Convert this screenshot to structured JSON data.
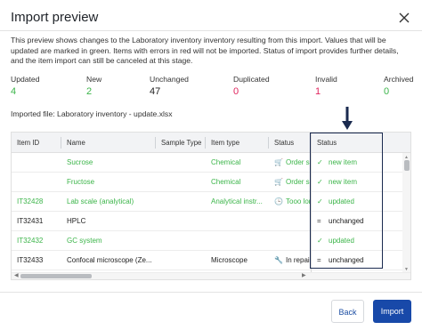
{
  "dialog": {
    "title": "Import preview",
    "description": "This preview shows changes to the Laboratory inventory inventory resulting from this import. Values that will be updated are marked in green. Items with errors in red will not be imported. Status of import provides further details, and the item import can still be canceled at this stage.",
    "imported_file": "Imported file: Laboratory inventory - update.xlsx"
  },
  "stats": [
    {
      "label": "Updated",
      "value": "4",
      "color": "#3cb54a"
    },
    {
      "label": "New",
      "value": "2",
      "color": "#3cb54a"
    },
    {
      "label": "Unchanged",
      "value": "47",
      "color": "#222222"
    },
    {
      "label": "Duplicated",
      "value": "0",
      "color": "#e0245e"
    },
    {
      "label": "Invalid",
      "value": "1",
      "color": "#e0245e"
    },
    {
      "label": "Archived",
      "value": "0",
      "color": "#3cb54a"
    }
  ],
  "table": {
    "headers": [
      "Item ID",
      "Name",
      "Sample Type",
      "Item type",
      "Status",
      "Status"
    ],
    "rows": [
      {
        "item_id": "",
        "name": "Sucrose",
        "sample_type": "",
        "item_type": "Chemical",
        "status_icon": "cart-icon",
        "status": "Order su",
        "import_icon": "check-icon",
        "import_status": "new item",
        "name_color": "green",
        "import_color": "green"
      },
      {
        "item_id": "",
        "name": "Fructose",
        "sample_type": "",
        "item_type": "Chemical",
        "status_icon": "cart-icon",
        "status": "Order su",
        "import_icon": "check-icon",
        "import_status": "new item",
        "name_color": "green",
        "import_color": "green"
      },
      {
        "item_id": "IT32428",
        "name": "Lab scale (analytical)",
        "sample_type": "",
        "item_type": "Analytical instr...",
        "status_icon": "clock-icon",
        "status": "Tooo lon",
        "import_icon": "check-icon",
        "import_status": "updated",
        "name_color": "green",
        "import_color": "green"
      },
      {
        "item_id": "IT32431",
        "name": "HPLC",
        "sample_type": "",
        "item_type": "",
        "status_icon": "",
        "status": "",
        "import_icon": "equals-icon",
        "import_status": "unchanged",
        "name_color": "dark",
        "import_color": "dark"
      },
      {
        "item_id": "IT32432",
        "name": "GC system",
        "sample_type": "",
        "item_type": "",
        "status_icon": "",
        "status": "",
        "import_icon": "check-icon",
        "import_status": "updated",
        "name_color": "green",
        "import_color": "green"
      },
      {
        "item_id": "IT32433",
        "name": "Confocal microscope (Ze...",
        "sample_type": "",
        "item_type": "Microscope",
        "status_icon": "wrench-icon",
        "status": "In repair",
        "import_icon": "equals-icon",
        "import_status": "unchanged",
        "name_color": "dark",
        "import_color": "dark"
      }
    ]
  },
  "buttons": {
    "back": "Back",
    "import": "Import"
  },
  "colors": {
    "green": "#3cb54a",
    "red": "#e0245e",
    "primary": "#1849a9",
    "highlight": "#1a2a4f"
  }
}
